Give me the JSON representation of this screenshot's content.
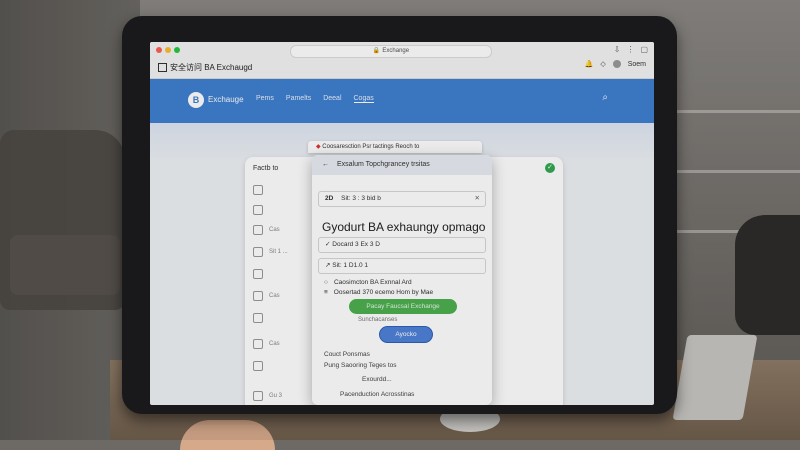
{
  "browser": {
    "url": "Exchange",
    "site_title": "安全访问 BA Exchaugd",
    "top_right_label": "Soem"
  },
  "nav": {
    "logo_letter": "B",
    "brand": "Exchauge",
    "links": [
      "Pems",
      "Pamelts",
      "Deeal",
      "Cogas"
    ]
  },
  "bg_card": {
    "header": "Factb to",
    "rows_left": [
      "",
      "",
      "Cas",
      "Sit 1 ...",
      "",
      "Cas",
      "",
      "Cas",
      "",
      "Gu 3"
    ],
    "rows_right": [
      "",
      "",
      "",
      "",
      "",
      "",
      "",
      "",
      ""
    ]
  },
  "modal": {
    "top_strip": "Coosaresction Psr tactings Reoch to",
    "head": "Exsalum Topchgrancey trsitas",
    "field1_label": "2D",
    "field1_value": "Sit: 3 : 3 bid b",
    "title": "Gyodurt BA exhaungy opmago",
    "field2": "Docard 3 Ex 3 D",
    "field3": "Sit: 1 D1.0 1",
    "desc1": "Caosimcton BA Exnnal Ard",
    "desc2": "Oosertad 370 ecemo Hom by Mae",
    "green_button": "Pacay Faucsal Exchange",
    "sub_text": "Sunchacanses",
    "blue_button": "Ayocko",
    "row1": "Couct    Ponsmas",
    "row2": "Pung Saooring Teges tos",
    "row3": "Exourdd...",
    "row4": "Pacenduction Acrosstinas"
  }
}
